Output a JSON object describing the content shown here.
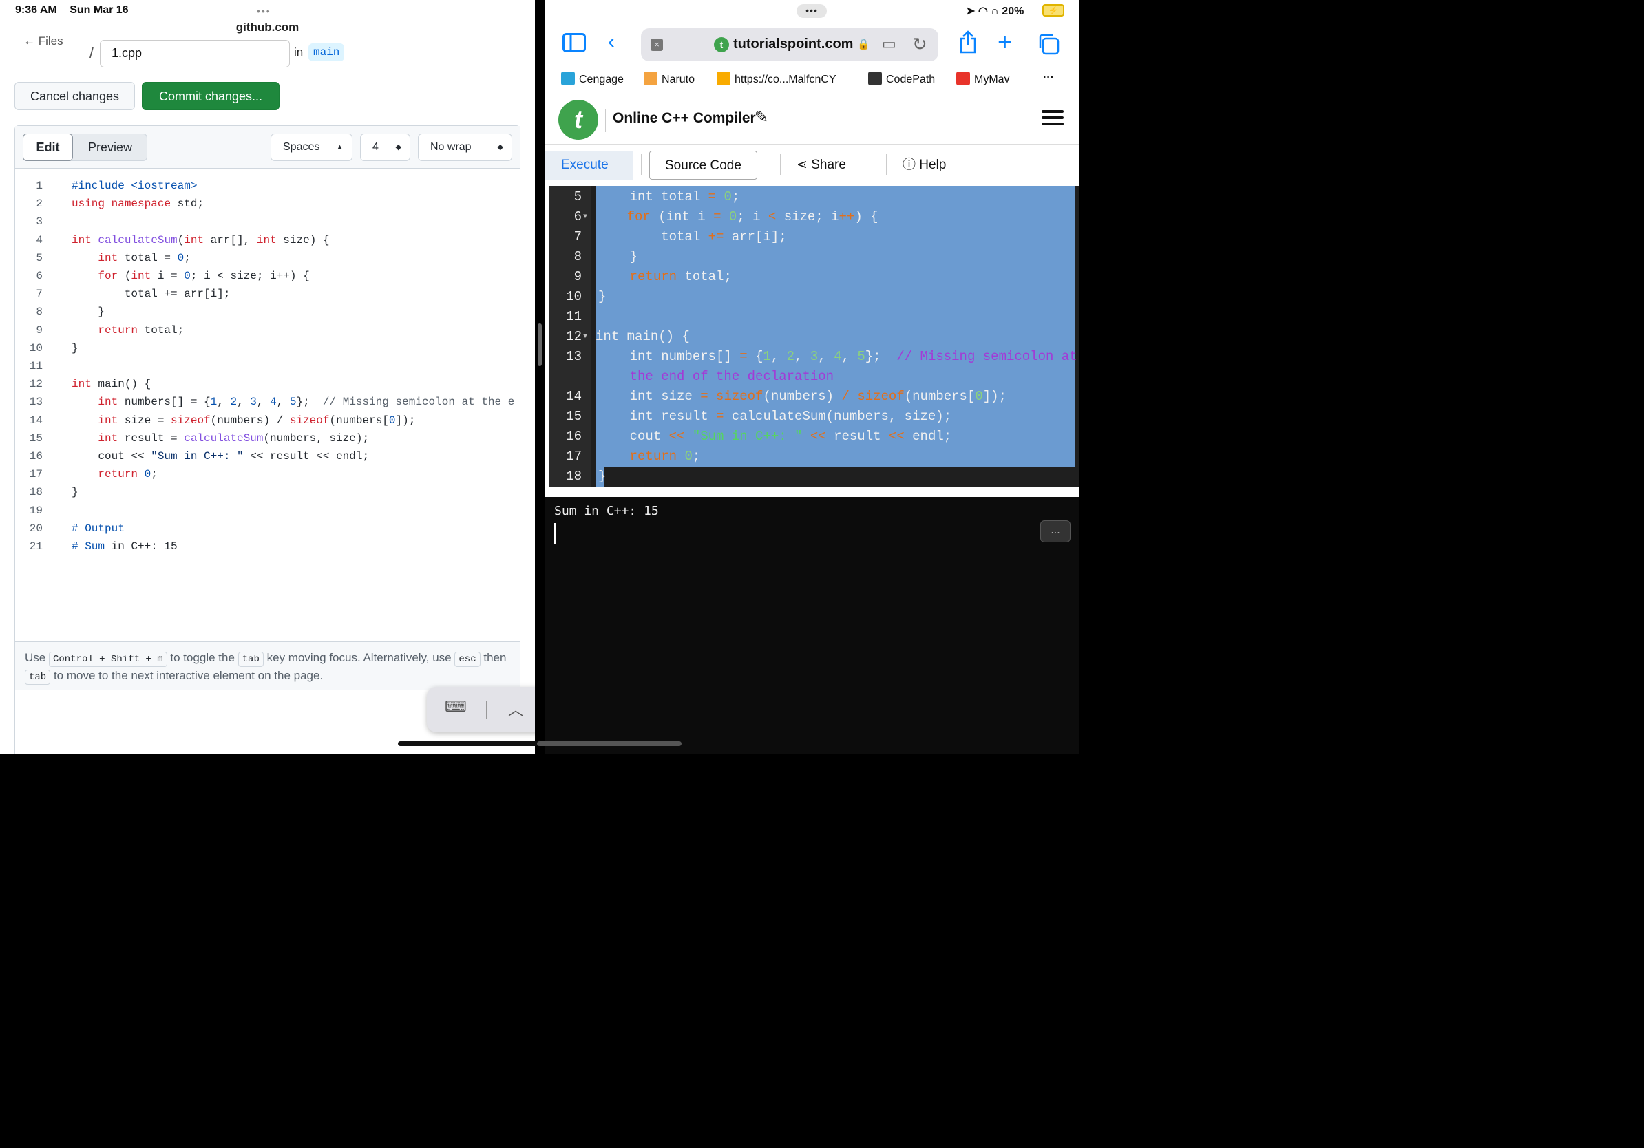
{
  "status_left": {
    "time": "9:36 AM",
    "date": "Sun Mar 16",
    "url": "github.com"
  },
  "github": {
    "back_label": "← Files",
    "filename": "1.cpp",
    "in_label": "in",
    "branch": "main",
    "cancel_label": "Cancel changes",
    "commit_label": "Commit changes...",
    "tab_edit": "Edit",
    "tab_preview": "Preview",
    "indent_mode": "Spaces",
    "indent_size": "4",
    "wrap_mode": "No wrap",
    "hint_parts": [
      "Use",
      "Control + Shift + m",
      "to toggle the",
      "tab",
      "key moving focus. Alternatively, use",
      "esc",
      "then",
      "tab",
      "to move to the next interactive element on the page."
    ]
  },
  "code_lines": [
    "#include <iostream>",
    "using namespace std;",
    "",
    "int calculateSum(int arr[], int size) {",
    "    int total = 0;",
    "    for (int i = 0; i < size; i++) {",
    "        total += arr[i];",
    "    }",
    "    return total;",
    "}",
    "",
    "int main() {",
    "    int numbers[] = {1, 2, 3, 4, 5};  // Missing semicolon at the e",
    "    int size = sizeof(numbers) / sizeof(numbers[0]);",
    "    int result = calculateSum(numbers, size);",
    "    cout << \"Sum in C++: \" << result << endl;",
    "    return 0;",
    "}",
    "",
    "# Output",
    "# Sum in C++: 15"
  ],
  "status_right": {
    "battery": "20%"
  },
  "safari": {
    "domain": "tutorialspoint.com",
    "bookmarks": [
      "Cengage",
      "Naruto",
      "https://co...MalfcnCY",
      "CodePath",
      "MyMav"
    ],
    "more": "···"
  },
  "compiler": {
    "title": "Online C++ Compiler",
    "tabs": {
      "execute": "Execute",
      "source": "Source Code",
      "share": "Share",
      "help": "Help"
    },
    "ace_line_numbers": [
      "5",
      "6",
      "7",
      "8",
      "9",
      "10",
      "11",
      "12",
      "13",
      "",
      "14",
      "15",
      "16",
      "17",
      "18"
    ],
    "output_text": "Sum in C++: 15",
    "console_more": "..."
  }
}
